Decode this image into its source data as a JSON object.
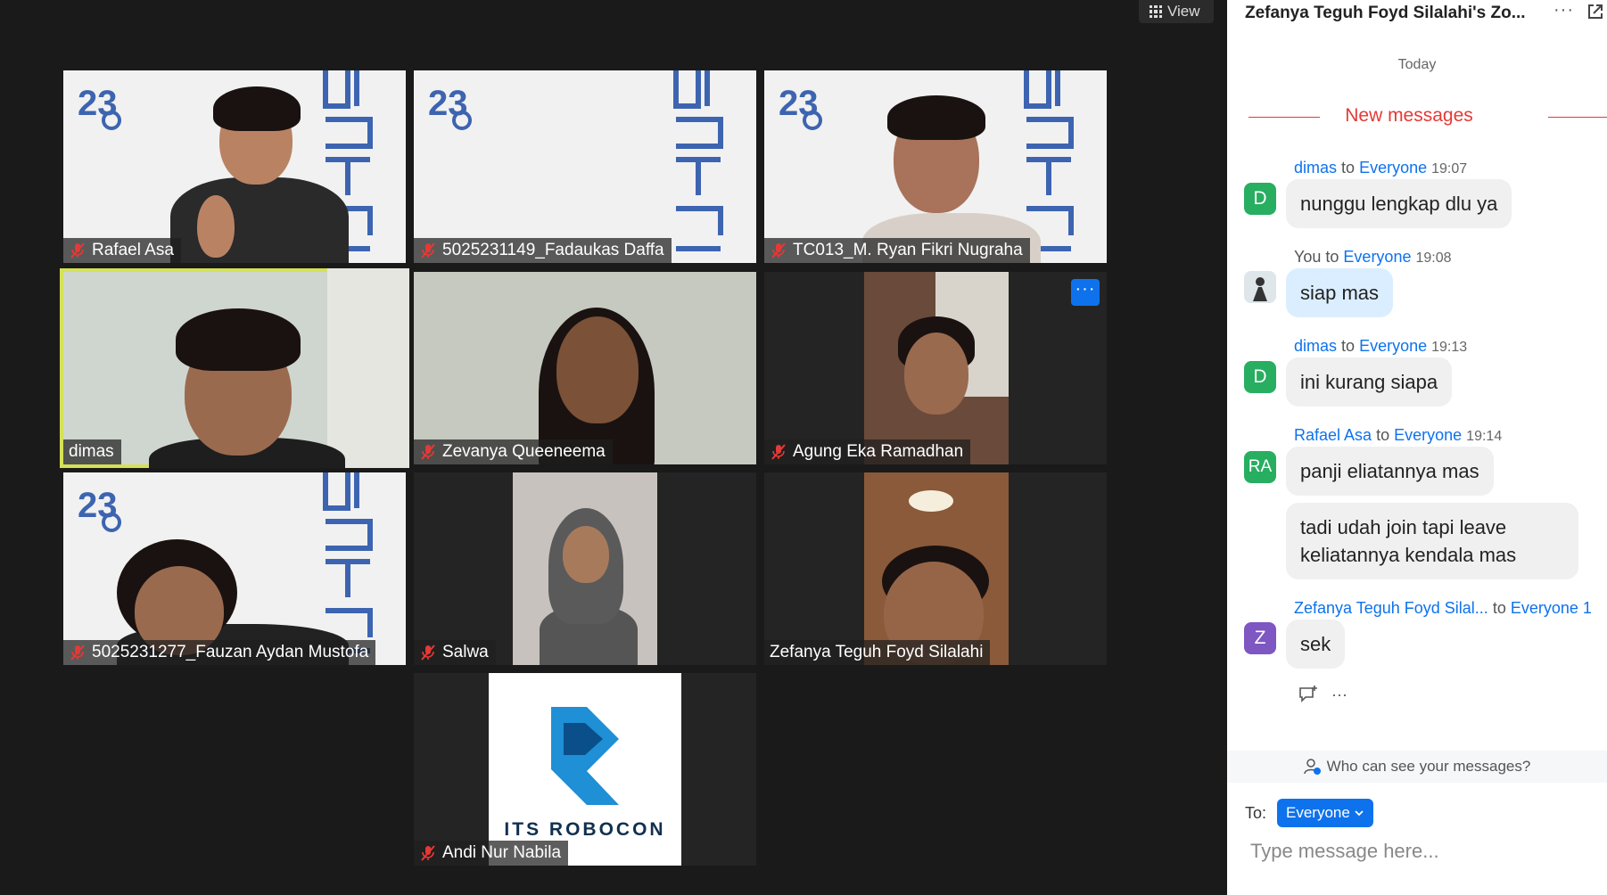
{
  "toolbar": {
    "view_label": "View"
  },
  "participants": [
    {
      "name": "Rafael Asa",
      "muted": true
    },
    {
      "name": "5025231149_Fadaukas Daffa",
      "muted": true
    },
    {
      "name": "TC013_M. Ryan Fikri Nugraha",
      "muted": true
    },
    {
      "name": "dimas",
      "muted": false,
      "speaking": true
    },
    {
      "name": "Zevanya Queeneema",
      "muted": true
    },
    {
      "name": "Agung Eka Ramadhan",
      "muted": true
    },
    {
      "name": "5025231277_Fauzan Aydan Mustofa",
      "muted": true
    },
    {
      "name": "Salwa",
      "muted": true
    },
    {
      "name": "Zefanya Teguh Foyd Silalahi",
      "muted": false
    },
    {
      "name": "Andi Nur Nabila",
      "muted": true
    }
  ],
  "brand": {
    "robocon_text": "ITS ROBOCON",
    "more_dots": "···"
  },
  "chat": {
    "title": "Zefanya Teguh Foyd Silalahi's Zo...",
    "header_dots": "···",
    "today": "Today",
    "new_messages": "New messages",
    "messages": [
      {
        "sender": "dimas",
        "to": "to",
        "recipient": "Everyone",
        "time": "19:07",
        "avatar": "D",
        "avatar_color": "#27ae60",
        "texts": [
          "nunggu lengkap dlu ya"
        ]
      },
      {
        "sender": "You",
        "to": "to",
        "recipient": "Everyone",
        "time": "19:08",
        "avatar": "",
        "avatar_color": "#cfd8dc",
        "texts": [
          "siap mas"
        ]
      },
      {
        "sender": "dimas",
        "to": "to",
        "recipient": "Everyone",
        "time": "19:13",
        "avatar": "D",
        "avatar_color": "#27ae60",
        "texts": [
          "ini kurang siapa"
        ]
      },
      {
        "sender": "Rafael Asa",
        "to": "to",
        "recipient": "Everyone",
        "time": "19:14",
        "avatar": "RA",
        "avatar_color": "#27ae60",
        "texts": [
          "panji eliatannya mas",
          "tadi udah join tapi leave keliatannya kendala mas"
        ]
      },
      {
        "sender": "Zefanya Teguh Foyd Silal...",
        "to": "to",
        "recipient": "Everyone",
        "time": "1",
        "avatar": "Z",
        "avatar_color": "#7e57c2",
        "texts": [
          "sek"
        ]
      }
    ],
    "reaction_more": "···",
    "who_can_see": "Who can see your messages?",
    "to_label": "To:",
    "to_value": "Everyone",
    "input_placeholder": "Type message here..."
  }
}
